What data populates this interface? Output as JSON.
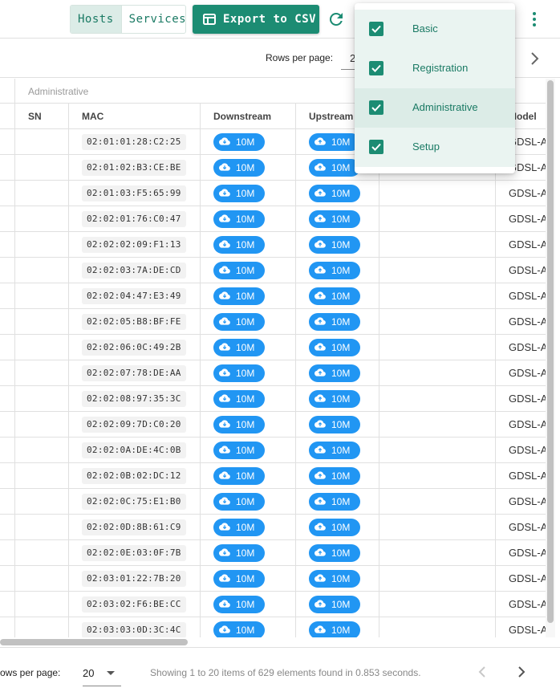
{
  "toolbar": {
    "view_toggle": {
      "hosts_label": "Hosts",
      "services_label": "Services",
      "selected": "Hosts"
    },
    "export_label": "Export to CSV",
    "colors": {
      "accent": "#1c8c73",
      "chip": "#2196f3"
    }
  },
  "top_pagination": {
    "rows_per_page_label": "Rows per page:",
    "rows_value_partial": "2"
  },
  "table": {
    "group_label": "Administrative",
    "columns": {
      "sn": "SN",
      "mac": "MAC",
      "downstream": "Downstream",
      "upstream": "Upstream",
      "model": "Model"
    },
    "rows": [
      {
        "mac": "02:01:01:28:C2:25",
        "downstream": "10M",
        "upstream": "10M",
        "model": "GDSL-A"
      },
      {
        "mac": "02:01:02:B3:CE:BE",
        "downstream": "10M",
        "upstream": "10M",
        "model": "GDSL-A"
      },
      {
        "mac": "02:01:03:F5:65:99",
        "downstream": "10M",
        "upstream": "10M",
        "model": "GDSL-A"
      },
      {
        "mac": "02:02:01:76:C0:47",
        "downstream": "10M",
        "upstream": "10M",
        "model": "GDSL-A"
      },
      {
        "mac": "02:02:02:09:F1:13",
        "downstream": "10M",
        "upstream": "10M",
        "model": "GDSL-A"
      },
      {
        "mac": "02:02:03:7A:DE:CD",
        "downstream": "10M",
        "upstream": "10M",
        "model": "GDSL-A"
      },
      {
        "mac": "02:02:04:47:E3:49",
        "downstream": "10M",
        "upstream": "10M",
        "model": "GDSL-A"
      },
      {
        "mac": "02:02:05:B8:BF:FE",
        "downstream": "10M",
        "upstream": "10M",
        "model": "GDSL-A"
      },
      {
        "mac": "02:02:06:0C:49:2B",
        "downstream": "10M",
        "upstream": "10M",
        "model": "GDSL-A"
      },
      {
        "mac": "02:02:07:78:DE:AA",
        "downstream": "10M",
        "upstream": "10M",
        "model": "GDSL-A"
      },
      {
        "mac": "02:02:08:97:35:3C",
        "downstream": "10M",
        "upstream": "10M",
        "model": "GDSL-A"
      },
      {
        "mac": "02:02:09:7D:C0:20",
        "downstream": "10M",
        "upstream": "10M",
        "model": "GDSL-A"
      },
      {
        "mac": "02:02:0A:DE:4C:0B",
        "downstream": "10M",
        "upstream": "10M",
        "model": "GDSL-A"
      },
      {
        "mac": "02:02:0B:02:DC:12",
        "downstream": "10M",
        "upstream": "10M",
        "model": "GDSL-A"
      },
      {
        "mac": "02:02:0C:75:E1:B0",
        "downstream": "10M",
        "upstream": "10M",
        "model": "GDSL-A"
      },
      {
        "mac": "02:02:0D:8B:61:C9",
        "downstream": "10M",
        "upstream": "10M",
        "model": "GDSL-A"
      },
      {
        "mac": "02:02:0E:03:0F:7B",
        "downstream": "10M",
        "upstream": "10M",
        "model": "GDSL-A"
      },
      {
        "mac": "02:03:01:22:7B:20",
        "downstream": "10M",
        "upstream": "10M",
        "model": "GDSL-A"
      },
      {
        "mac": "02:03:02:F6:BE:CC",
        "downstream": "10M",
        "upstream": "10M",
        "model": "GDSL-A"
      },
      {
        "mac": "02:03:03:0D:3C:4C",
        "downstream": "10M",
        "upstream": "10M",
        "model": "GDSL-A"
      }
    ]
  },
  "footer": {
    "rows_per_page_label": "ows per page:",
    "rows_per_page_value": "20",
    "info": "Showing 1 to 20 items of 629 elements found in 0.853 seconds."
  },
  "column_menu": {
    "items": [
      {
        "label": "Basic",
        "checked": true
      },
      {
        "label": "Registration",
        "checked": true
      },
      {
        "label": "Administrative",
        "checked": true,
        "highlighted": true
      },
      {
        "label": "Setup",
        "checked": true
      }
    ]
  }
}
